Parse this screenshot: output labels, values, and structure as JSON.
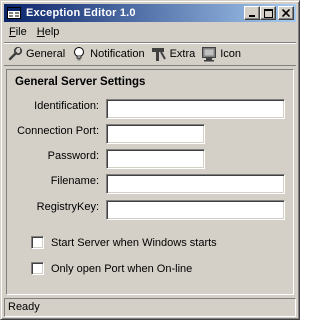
{
  "window": {
    "title": "Exception Editor 1.0",
    "minimize_label": "_",
    "maximize_label": "□",
    "close_label": "×"
  },
  "menu": [
    {
      "label": "File",
      "underline": "F",
      "rest": "ile"
    },
    {
      "label": "Help",
      "underline": "H",
      "rest": "elp"
    }
  ],
  "toolbar": [
    {
      "label": "General",
      "icon": "wrench-icon"
    },
    {
      "label": "Notification",
      "icon": "lightbulb-icon"
    },
    {
      "label": "Extra",
      "icon": "tools-icon"
    },
    {
      "label": "Icon",
      "icon": "monitor-icon"
    }
  ],
  "panel": {
    "section_title": "General Server Settings",
    "fields": [
      {
        "label": "Identification:",
        "value": ""
      },
      {
        "label": "Connection Port:",
        "value": ""
      },
      {
        "label": "Password:",
        "value": ""
      },
      {
        "label": "Filename:",
        "value": ""
      },
      {
        "label": "RegistryKey:",
        "value": ""
      }
    ],
    "checkboxes": [
      {
        "label": "Start Server when Windows starts",
        "checked": false
      },
      {
        "label": "Only open Port when On-line",
        "checked": false
      }
    ]
  },
  "status": {
    "text": "Ready"
  }
}
